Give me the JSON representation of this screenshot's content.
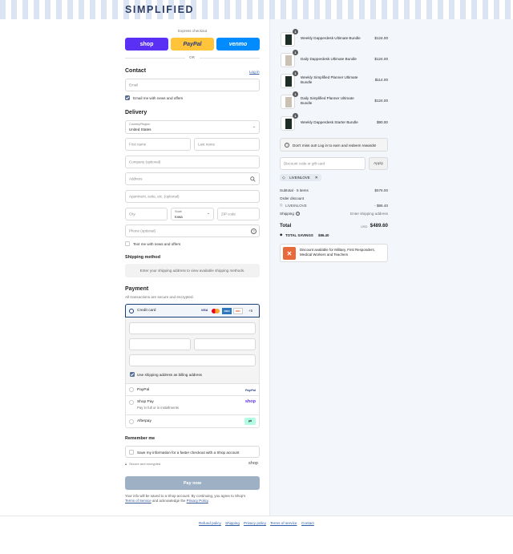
{
  "brand": {
    "logo": "SIMPLIFIED"
  },
  "express": {
    "label": "Express checkout",
    "shop": "shop",
    "paypal": "PayPal",
    "venmo": "venmo",
    "or": "OR"
  },
  "contact": {
    "heading": "Contact",
    "login": "Log in",
    "email_placeholder": "Email",
    "news_label": "Email me with news and offers"
  },
  "delivery": {
    "heading": "Delivery",
    "country_label": "Country/Region",
    "country_value": "United States",
    "first_name": "First name",
    "last_name": "Last name",
    "company": "Company (optional)",
    "address": "Address",
    "apartment": "Apartment, suite, etc. (optional)",
    "city": "City",
    "state_label": "State",
    "state_value": "Iowa",
    "zip": "ZIP code",
    "phone": "Phone (optional)",
    "text_label": "Text me with news and offers"
  },
  "shipping_method": {
    "heading": "Shipping method",
    "notice": "Enter your shipping address to view available shipping methods."
  },
  "payment": {
    "heading": "Payment",
    "subtext": "All transactions are secure and encrypted.",
    "credit_card": "Credit card",
    "card_brands": [
      "VISA",
      "MC",
      "AMEX",
      "DISC"
    ],
    "more_cards": "+5",
    "billing_label": "Use shipping address as billing address",
    "paypal": "PayPal",
    "paypal_logo": "PayPal",
    "shop_pay": "Shop Pay",
    "shop_pay_sub": "Pay in full or in installments",
    "shop_logo": "shop",
    "afterpay": "Afterpay"
  },
  "remember": {
    "heading": "Remember me",
    "save_label": "Save my information for a faster checkout with a Shop account",
    "secure": "Secure and encrypted",
    "shop_logo": "shop"
  },
  "pay_button": "Pay now",
  "legal": {
    "text": "Your info will be saved to a Shop account. By continuing, you agree to Shop's",
    "terms": "Terms of Service",
    "and": "and acknowledge the",
    "privacy": "Privacy Policy",
    "end": "."
  },
  "cart": {
    "items": [
      {
        "qty": "1",
        "name": "Weekly Dapperdesk Ultimate Bundle",
        "price": "$124.00"
      },
      {
        "qty": "1",
        "name": "Daily Dapperdesk Ultimate Bundle",
        "price": "$124.00"
      },
      {
        "qty": "1",
        "name": "Weekly Simplified Planner Ultimate Bundle",
        "price": "$114.00"
      },
      {
        "qty": "1",
        "name": "Daily Simplified Planner Ultimate Bundle",
        "price": "$124.00"
      },
      {
        "qty": "1",
        "name": "Weekly Dapperdesk Starter Bundle",
        "price": "$90.00"
      }
    ],
    "rewards_notice": "Don't miss out! Log in to earn and redeem rewards!",
    "discount_placeholder": "Discount code or gift card",
    "apply": "Apply",
    "code_tag": "LIVEINLOVE",
    "subtotal_label": "Subtotal · 5 items",
    "subtotal_value": "$576.00",
    "order_discount": "Order discount",
    "discount_code": "LIVEINLOVE",
    "discount_value": "- $86.40",
    "shipping_label": "Shipping",
    "shipping_value": "Enter shipping address",
    "total_label": "Total",
    "currency": "USD",
    "total_value": "$489.60",
    "savings_label": "TOTAL SAVINGS",
    "savings_value": "$86.40",
    "military_text": "Discount available for Military, First Responders, Medical Workers and Teachers"
  },
  "footer": {
    "links": [
      "Refund policy",
      "Shipping",
      "Privacy policy",
      "Terms of service",
      "Contact"
    ]
  },
  "colors": {
    "shop_purple": "#5a31f4",
    "paypal_yellow": "#ffc439",
    "venmo_blue": "#008cff",
    "pay_button": "#9eb0c4",
    "accent_navy": "#1a3d7c"
  }
}
